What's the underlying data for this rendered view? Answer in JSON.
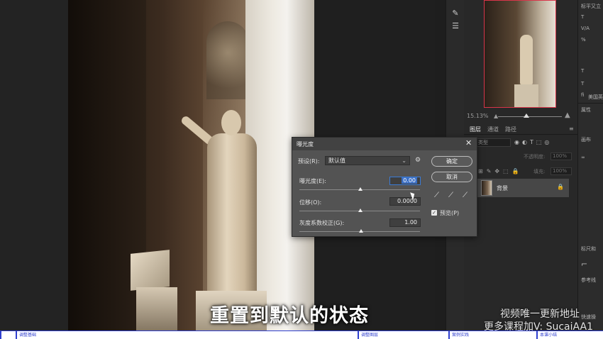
{
  "dialog": {
    "title": "曝光度",
    "preset_label": "预设(R):",
    "preset_value": "默认值",
    "ok_label": "确定",
    "cancel_label": "取消",
    "exposure_label": "曝光度(E):",
    "exposure_value": "0.00",
    "offset_label": "位移(O):",
    "offset_value": "0.0000",
    "gamma_label": "灰度系数校正(G):",
    "gamma_value": "1.00",
    "preview_label": "预览(P)",
    "preview_checked": true,
    "close_icon": "close-icon",
    "settings_icon": "gear-icon"
  },
  "navigator": {
    "zoom": "15.13%"
  },
  "layers_panel": {
    "tabs": [
      "图层",
      "通道",
      "路径"
    ],
    "kind_placeholder": "类型",
    "opacity_label": "不透明度:",
    "opacity_value": "100%",
    "fill_label": "填充:",
    "fill_value": "100%",
    "layer_name": "背景"
  },
  "right_strip": {
    "items": [
      "标平又立",
      "T",
      "V/A",
      "%",
      "T",
      "T",
      "fi",
      "美国英",
      "属性",
      "画布",
      "标尺和",
      "参考线",
      "快速操"
    ]
  },
  "overlay": {
    "subtitle": "重置到默认的状态",
    "watermark_line1": "视频唯一更新地址",
    "watermark_line2": "更多课程加V: SucaiAA1"
  },
  "progress_bar": {
    "segments": [
      "调整基础",
      "调整图层",
      "案例实践",
      "本课小结"
    ]
  },
  "colors": {
    "accent": "#3a7bd5",
    "dialog_bg": "#535353",
    "panel_bg": "#282828",
    "nav_border": "#d8354a",
    "progress_accent": "#2f3fd0"
  }
}
